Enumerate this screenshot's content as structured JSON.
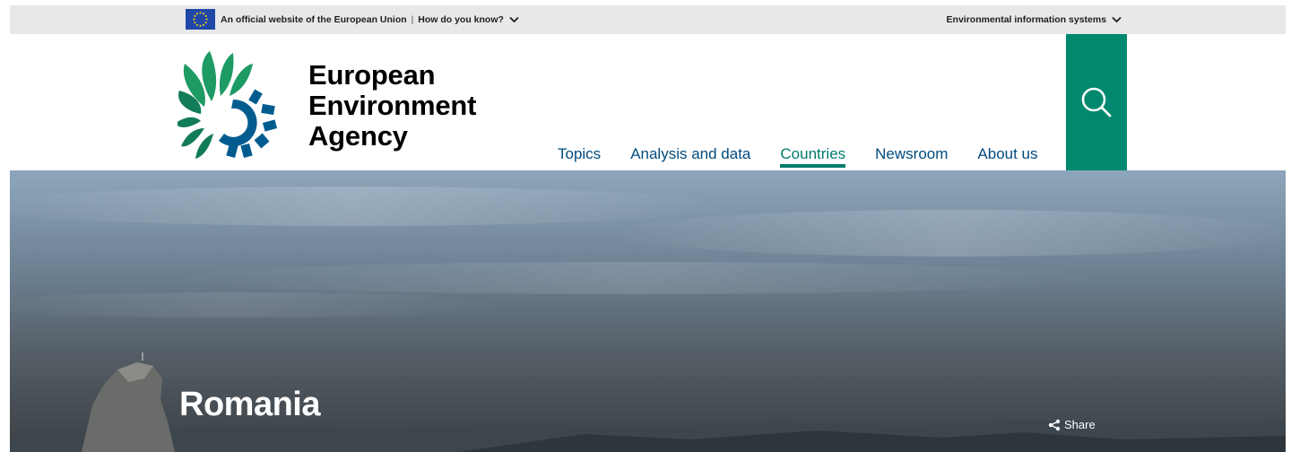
{
  "topbar": {
    "official_text": "An official website of the European Union",
    "separator": "|",
    "how_know": "How do you know?",
    "env_systems": "Environmental information systems"
  },
  "logo": {
    "line1": "European",
    "line2": "Environment",
    "line3": "Agency"
  },
  "nav": {
    "items": [
      {
        "label": "Topics"
      },
      {
        "label": "Analysis and data"
      },
      {
        "label": "Countries"
      },
      {
        "label": "Newsroom"
      },
      {
        "label": "About us"
      }
    ]
  },
  "hero": {
    "title": "Romania",
    "share_label": "Share"
  },
  "icons": {
    "flag": "eu-flag-icon",
    "chevron": "chevron-down-icon",
    "search": "search-icon",
    "share": "share-icon"
  },
  "colors": {
    "nav_text": "#004b7f",
    "active": "#007b6c",
    "search_bg": "#00896f",
    "topbar_bg": "#e7e8e9"
  }
}
